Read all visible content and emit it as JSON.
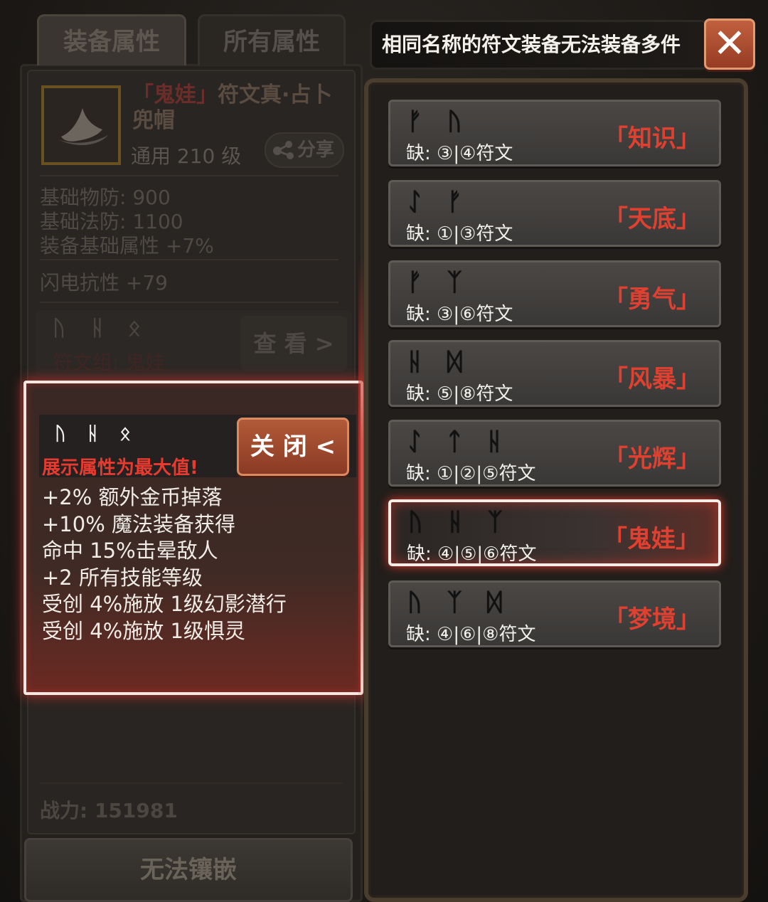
{
  "tabs": {
    "equip": "装备属性",
    "all": "所有属性"
  },
  "item": {
    "brand": "「鬼娃」",
    "name": "符文真·占卜兜帽",
    "sub": "通用 210 级",
    "share": "分享",
    "stats": [
      "基础物防: 900",
      "基础法防: 1100",
      "装备基础属性 +7%"
    ],
    "extra": "闪电抗性 +79",
    "runes": [
      "ᚢ",
      "ᚺ",
      "ᛟ"
    ],
    "runes_label": "符文组: 鬼娃",
    "view": "查 看 >",
    "power": "战力: 151981",
    "inlay": "无法镶嵌"
  },
  "popup": {
    "runes": "ᚢᚺᛟ",
    "note": "展示属性为最大值!",
    "close": "关 闭 <",
    "lines": [
      "+2% 额外金币掉落",
      "+10% 魔法装备获得",
      "命中 15%击晕敌人",
      "+2 所有技能等级",
      "受创 4%施放 1级幻影潜行",
      "受创 4%施放 1级惧灵"
    ]
  },
  "warning": "相同名称的符文装备无法装备多件",
  "runewords": [
    {
      "glyphs": [
        "ᚠ",
        "ᚢ"
      ],
      "missing": "缺: ③|④符文",
      "name": "「知识」"
    },
    {
      "glyphs": [
        "ᛇ",
        "ᚠ"
      ],
      "missing": "缺: ①|③符文",
      "name": "「天底」"
    },
    {
      "glyphs": [
        "ᚠ",
        "ᛉ"
      ],
      "missing": "缺: ③|⑥符文",
      "name": "「勇气」"
    },
    {
      "glyphs": [
        "ᚺ",
        "ᛞ"
      ],
      "missing": "缺: ⑤|⑧符文",
      "name": "「风暴」"
    },
    {
      "glyphs": [
        "ᛇ",
        "ᛏ",
        "ᚺ"
      ],
      "missing": "缺: ①|②|⑤符文",
      "name": "「光辉」"
    },
    {
      "glyphs": [
        "ᚢ",
        "ᚺ",
        "ᛉ"
      ],
      "missing": "缺: ④|⑤|⑥符文",
      "name": "「鬼娃」"
    },
    {
      "glyphs": [
        "ᚢ",
        "ᛉ",
        "ᛞ"
      ],
      "missing": "缺: ④|⑥|⑧符文",
      "name": "「梦境」"
    }
  ]
}
